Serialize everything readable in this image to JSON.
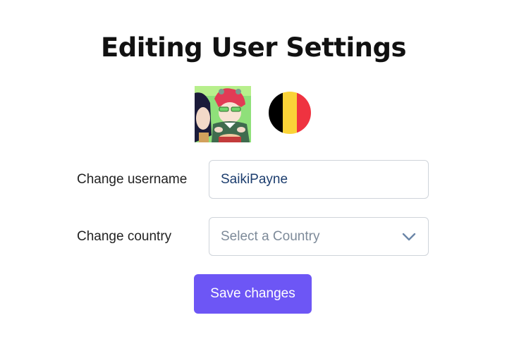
{
  "page": {
    "title": "Editing User Settings"
  },
  "profile": {
    "avatar": "avatar-image",
    "flag_colors": [
      "#000000",
      "#fad338",
      "#ef3340"
    ]
  },
  "form": {
    "username_label": "Change username",
    "username_value": "SaikiPayne",
    "country_label": "Change country",
    "country_placeholder": "Select a Country",
    "country_icon": "chevron-down-icon",
    "save_label": "Save changes"
  },
  "colors": {
    "accent": "#6d56f5",
    "input_text": "#1c3d6e",
    "placeholder": "#7d8a99"
  }
}
